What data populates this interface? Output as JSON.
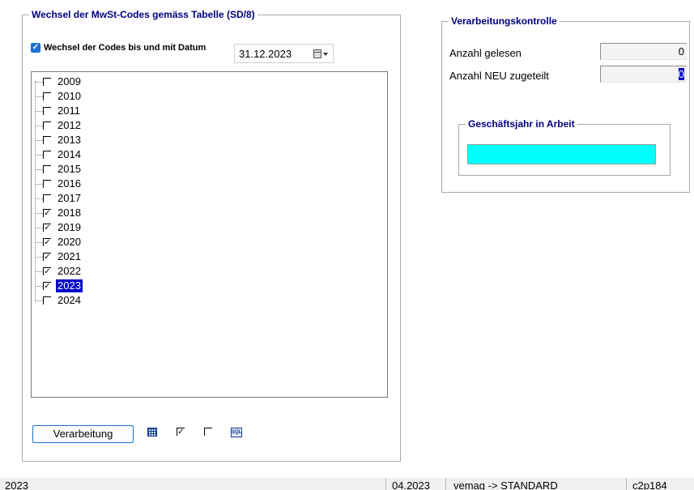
{
  "left_group": {
    "title": "Wechsel der MwSt-Codes gemäss Tabelle (SD/8)",
    "date_checkbox_label": "Wechsel der Codes bis und mit Datum",
    "date_value": "31.12.2023",
    "years": [
      {
        "label": "2009",
        "checked": false,
        "selected": false
      },
      {
        "label": "2010",
        "checked": false,
        "selected": false
      },
      {
        "label": "2011",
        "checked": false,
        "selected": false
      },
      {
        "label": "2012",
        "checked": false,
        "selected": false
      },
      {
        "label": "2013",
        "checked": false,
        "selected": false
      },
      {
        "label": "2014",
        "checked": false,
        "selected": false
      },
      {
        "label": "2015",
        "checked": false,
        "selected": false
      },
      {
        "label": "2016",
        "checked": false,
        "selected": false
      },
      {
        "label": "2017",
        "checked": false,
        "selected": false
      },
      {
        "label": "2018",
        "checked": true,
        "selected": false
      },
      {
        "label": "2019",
        "checked": true,
        "selected": false
      },
      {
        "label": "2020",
        "checked": true,
        "selected": false
      },
      {
        "label": "2021",
        "checked": true,
        "selected": false
      },
      {
        "label": "2022",
        "checked": true,
        "selected": false
      },
      {
        "label": "2023",
        "checked": true,
        "selected": true
      },
      {
        "label": "2024",
        "checked": false,
        "selected": false
      }
    ],
    "process_button": "Verarbeitung",
    "toolbar_icons": [
      "table-grid-icon",
      "check-all-icon",
      "uncheck-all-icon",
      "sql-icon"
    ]
  },
  "right_group": {
    "title": "Verarbeitungskontrolle",
    "read_label": "Anzahl gelesen",
    "read_value": "0",
    "new_label": "Anzahl NEU zugeteilt",
    "new_value": "0",
    "year_group_title": "Geschäftsjahr in Arbeit",
    "progress_color": "#00ffff"
  },
  "status_bar": {
    "year": "2023",
    "period": "04.2023",
    "connection": "vemag -> STANDARD",
    "code": "c2p184"
  }
}
